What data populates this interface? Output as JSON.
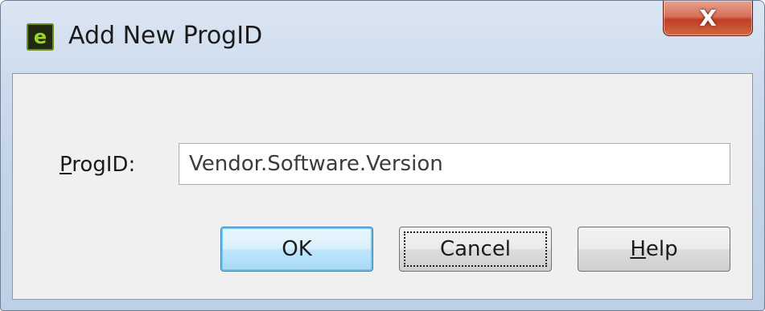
{
  "window": {
    "title": "Add New ProgID",
    "close_glyph": "X",
    "icon": "app-logo-icon"
  },
  "form": {
    "progid_label_accel": "P",
    "progid_label_rest": "rogID:",
    "progid_placeholder": "Vendor.Software.Version",
    "progid_value": ""
  },
  "buttons": {
    "ok": "OK",
    "cancel": "Cancel",
    "help_accel": "H",
    "help_rest": "elp"
  },
  "colors": {
    "close_button": "#c94a30",
    "default_button_border": "#3c7fb1",
    "dialog_background": "#f0f0f0"
  }
}
